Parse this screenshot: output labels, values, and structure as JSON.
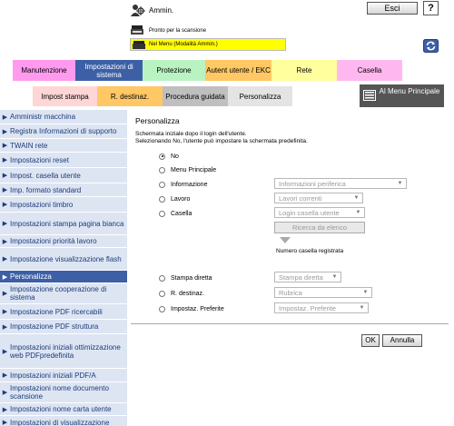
{
  "header": {
    "user_label": "Ammin.",
    "logout_label": "Esci",
    "help_label": "?",
    "status_text": "Pronto per la scansione",
    "menu_mode_text": "Nel Menu (Modalità Ammin.)"
  },
  "tabs_row1": [
    {
      "label": "Manutenzione",
      "color": "#ff9aef"
    },
    {
      "label": "Impostazioni di sistema",
      "color": "#3d5fa6",
      "active": true
    },
    {
      "label": "Protezione",
      "color": "#baf3c2"
    },
    {
      "label": "Autent utente / EKC",
      "color": "#ffc864"
    },
    {
      "label": "Rete",
      "color": "#ffff9e"
    },
    {
      "label": "Casella",
      "color": "#ffb8ef"
    }
  ],
  "tabs_row2": [
    {
      "label": "Impost stampa",
      "color": "#ffd6d6"
    },
    {
      "label": "R. destinaz.",
      "color": "#ffc864"
    },
    {
      "label": "Procedura guidata",
      "color": "#bfbfbf"
    },
    {
      "label": "Personalizza",
      "color": "#e4e4e4"
    }
  ],
  "main_menu_label": "Al Menu Principale",
  "sidebar": {
    "items": [
      {
        "label": "Amministr macchina"
      },
      {
        "label": "Registra Informazioni di supporto"
      },
      {
        "label": "TWAIN rete"
      },
      {
        "label": "Impostazioni reset"
      },
      {
        "label": "Impost. casella utente"
      },
      {
        "label": "Imp. formato standard"
      },
      {
        "label": "Impostazioni timbro"
      },
      {
        "label": "Impostazioni stampa pagina bianca"
      },
      {
        "label": "Impostazioni priorità lavoro"
      },
      {
        "label": "Impostazione visualizzazione flash"
      },
      {
        "label": "Personalizza",
        "active": true
      },
      {
        "label": "Impostazione cooperazione di sistema"
      },
      {
        "label": "Impostazione PDF ricercabili"
      },
      {
        "label": "Impostazione PDF struttura"
      },
      {
        "label": "Impostazioni iniziali ottimizzazione web PDFpredefinita"
      },
      {
        "label": "Impostazioni iniziali PDF/A"
      },
      {
        "label": "Impostazioni nome documento scansione"
      },
      {
        "label": "Impostazioni nome carta utente"
      },
      {
        "label": "Impostazioni di visualizzazione"
      }
    ]
  },
  "main": {
    "title": "Personalizza",
    "description_line1": "Schermata iniziale dopo il login dell'utente.",
    "description_line2": "Selezionando No, l'utente può impostare la schermata predefinita.",
    "options": [
      {
        "label": "No",
        "checked": true
      },
      {
        "label": "Menu Principale",
        "checked": false
      },
      {
        "label": "Informazione",
        "checked": false,
        "select_value": "Informazioni periferica"
      },
      {
        "label": "Lavoro",
        "checked": false,
        "select_value": "Lavori correnti"
      },
      {
        "label": "Casella",
        "checked": false,
        "select_value": "Login casella utente"
      },
      {
        "label": "Stampa diretta",
        "checked": false,
        "select_value": "Stampa diretta"
      },
      {
        "label": "R. destinaz.",
        "checked": false,
        "select_value": "Rubrica"
      },
      {
        "label": "Impostaz. Preferite",
        "checked": false,
        "select_value": "Impostaz. Preferite"
      }
    ],
    "search_list_button": "Ricerca da elenco",
    "box_registered_label": "Numero casella registrata",
    "ok_label": "OK",
    "cancel_label": "Annulla"
  }
}
